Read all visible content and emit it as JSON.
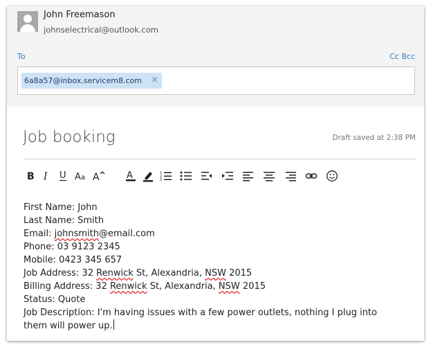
{
  "sender": {
    "name": "John Freemason",
    "email": "johnselectrical@outlook.com"
  },
  "to_label": "To",
  "cc_bcc_label": "Cc Bcc",
  "recipients": [
    {
      "address": "6a8a57@inbox.servicem8.com",
      "remove": "×"
    }
  ],
  "subject": "Job booking",
  "draft_status": "Draft saved at 2:38 PM",
  "toolbar": {
    "items": [
      {
        "icon": "bold-icon"
      },
      {
        "icon": "italic-icon"
      },
      {
        "icon": "underline-icon"
      },
      {
        "icon": "font-size-icon"
      },
      {
        "icon": "grow-font-icon"
      },
      {
        "icon": "font-color-icon"
      },
      {
        "icon": "highlight-icon"
      },
      {
        "icon": "numbered-list-icon"
      },
      {
        "icon": "bulleted-list-icon"
      },
      {
        "icon": "decrease-indent-icon"
      },
      {
        "icon": "increase-indent-icon"
      },
      {
        "icon": "align-left-icon"
      },
      {
        "icon": "align-center-icon"
      },
      {
        "icon": "align-right-icon"
      },
      {
        "icon": "link-icon"
      },
      {
        "icon": "emoji-icon"
      }
    ]
  },
  "body": {
    "first_name": "First Name: John",
    "last_name": "Last Name: Smith",
    "email_label": "Email: ",
    "email_value": "johnsmith",
    "email_domain": "@email.com",
    "phone": "Phone: 03 9123 2345",
    "mobile": "Mobile: 0423 345 657",
    "job_address_prefix": "Job Address: 32 ",
    "job_address_street": "Renwick",
    "job_address_mid": " St, Alexandria, ",
    "job_address_state": "NSW",
    "job_address_post": " 2015",
    "billing_address_prefix": "Billing Address: 32 ",
    "billing_address_street": "Renwick",
    "billing_address_mid": " St, Alexandria, ",
    "billing_address_state": "NSW",
    "billing_address_post": " 2015",
    "status": "Status: Quote",
    "description_line1": "Job Description: I'm having issues with a few power outlets, nothing I plug into",
    "description_line2": "them will power up."
  },
  "colors": {
    "accent": "#2a7cc7",
    "chip": "#cde3f5",
    "header_bg": "#f4f4f4"
  }
}
